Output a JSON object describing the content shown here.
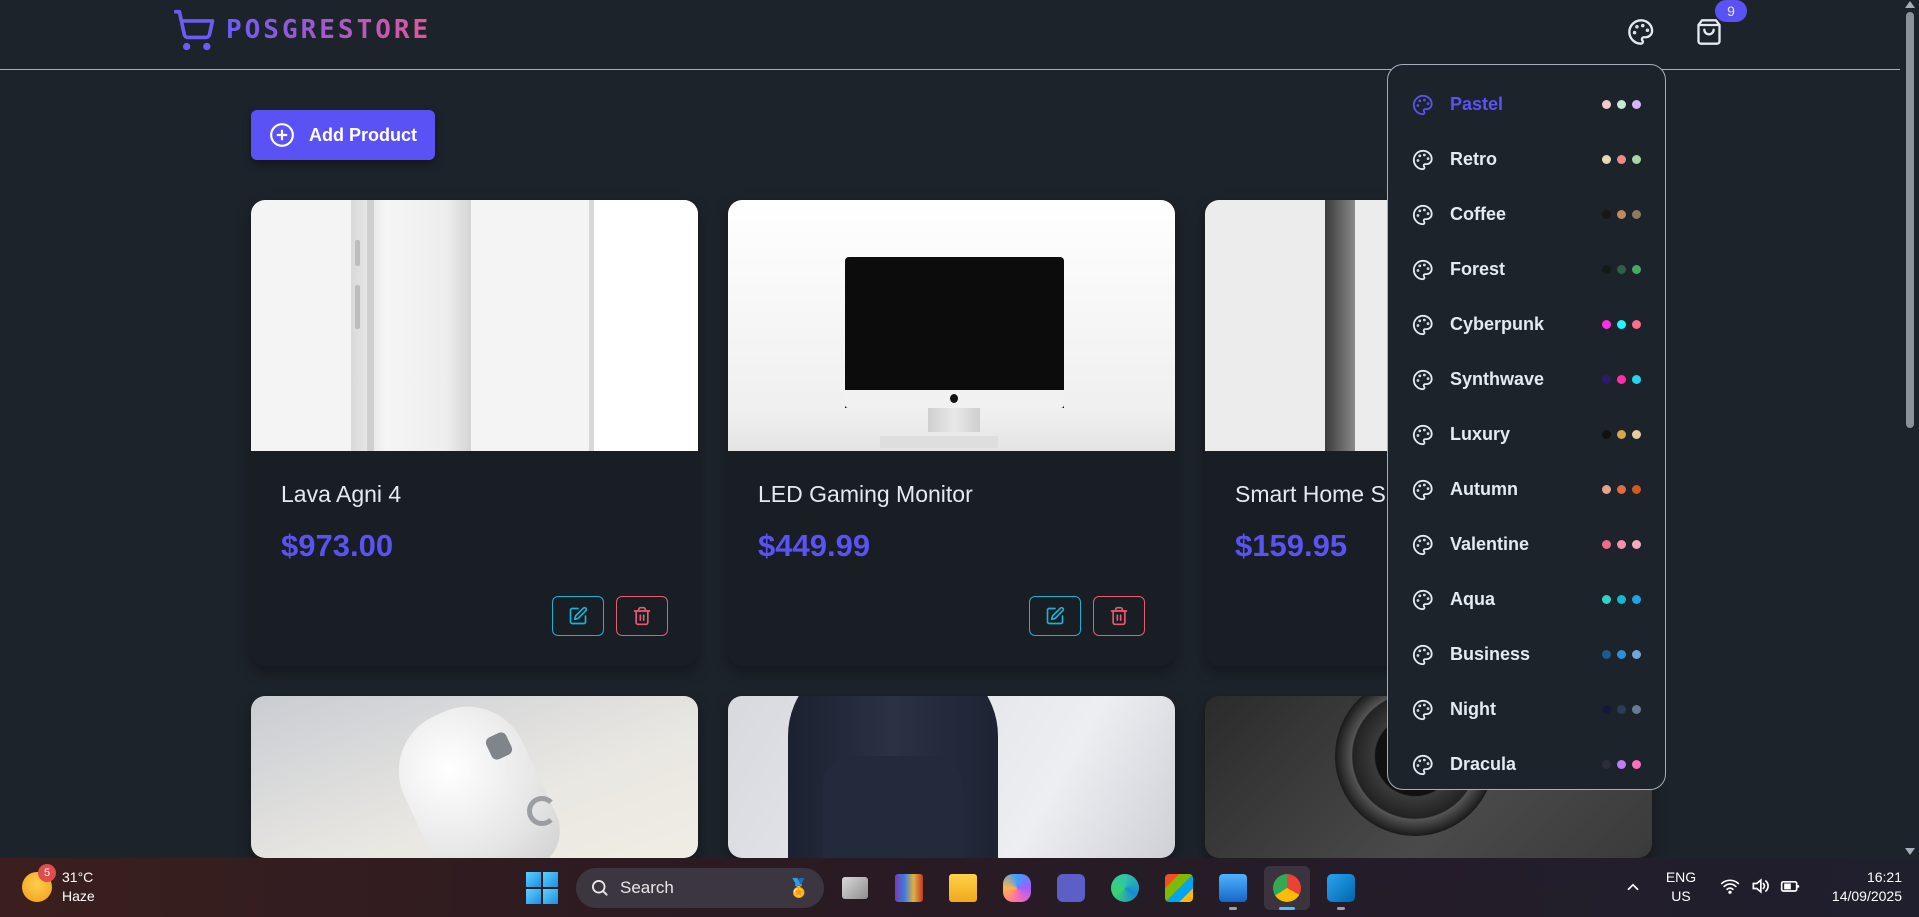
{
  "app": {
    "name": "POSGRESTORE"
  },
  "header": {
    "cart_count": "9"
  },
  "main": {
    "add_product_label": "Add Product"
  },
  "products": [
    {
      "name": "Lava Agni 4",
      "price": "$973.00",
      "image": "white-phone"
    },
    {
      "name": "LED Gaming Monitor",
      "price": "$449.99",
      "image": "imac"
    },
    {
      "name": "Smart Home Speaker",
      "price": "$159.95",
      "image": "speaker"
    },
    {
      "name": "",
      "price": "",
      "image": "white-mouse"
    },
    {
      "name": "",
      "price": "",
      "image": "backpack"
    },
    {
      "name": "",
      "price": "",
      "image": "camera-lens"
    }
  ],
  "theme_menu": {
    "selected": "Pastel",
    "themes": [
      {
        "name": "Pastel",
        "colors": [
          "#f4c9cf",
          "#c5ebd4",
          "#d9b5f5"
        ]
      },
      {
        "name": "Retro",
        "colors": [
          "#e8d9b5",
          "#ee8a8a",
          "#a8d5a3"
        ]
      },
      {
        "name": "Coffee",
        "colors": [
          "#1a1614",
          "#c08a5b",
          "#8c7a63"
        ]
      },
      {
        "name": "Forest",
        "colors": [
          "#141a16",
          "#2f5d45",
          "#3fae5f"
        ]
      },
      {
        "name": "Cyberpunk",
        "colors": [
          "#ff2ee6",
          "#1ff6ff",
          "#ff6b8b"
        ]
      },
      {
        "name": "Synthwave",
        "colors": [
          "#2b1a70",
          "#ff2ea6",
          "#20d6f2"
        ]
      },
      {
        "name": "Luxury",
        "colors": [
          "#111111",
          "#d3a94a",
          "#e5cf98"
        ]
      },
      {
        "name": "Autumn",
        "colors": [
          "#e2a48a",
          "#e16b43",
          "#d15a1e"
        ]
      },
      {
        "name": "Valentine",
        "colors": [
          "#f06a8a",
          "#f58fb0",
          "#f7a9c0"
        ]
      },
      {
        "name": "Aqua",
        "colors": [
          "#2ed3c6",
          "#15b8d6",
          "#1aa5e6"
        ]
      },
      {
        "name": "Business",
        "colors": [
          "#1e5a8f",
          "#2d8fd5",
          "#72a8d8"
        ]
      },
      {
        "name": "Night",
        "colors": [
          "#13193a",
          "#2f3a55",
          "#6a7a94"
        ]
      },
      {
        "name": "Dracula",
        "colors": [
          "#2b2d39",
          "#c07cf5",
          "#ff71c0"
        ]
      }
    ]
  },
  "taskbar": {
    "weather_temp": "31°C",
    "weather_desc": "Haze",
    "weather_badge": "5",
    "search_placeholder": "Search",
    "lang_line1": "ENG",
    "lang_line2": "US",
    "time": "16:21",
    "date": "14/09/2025"
  }
}
